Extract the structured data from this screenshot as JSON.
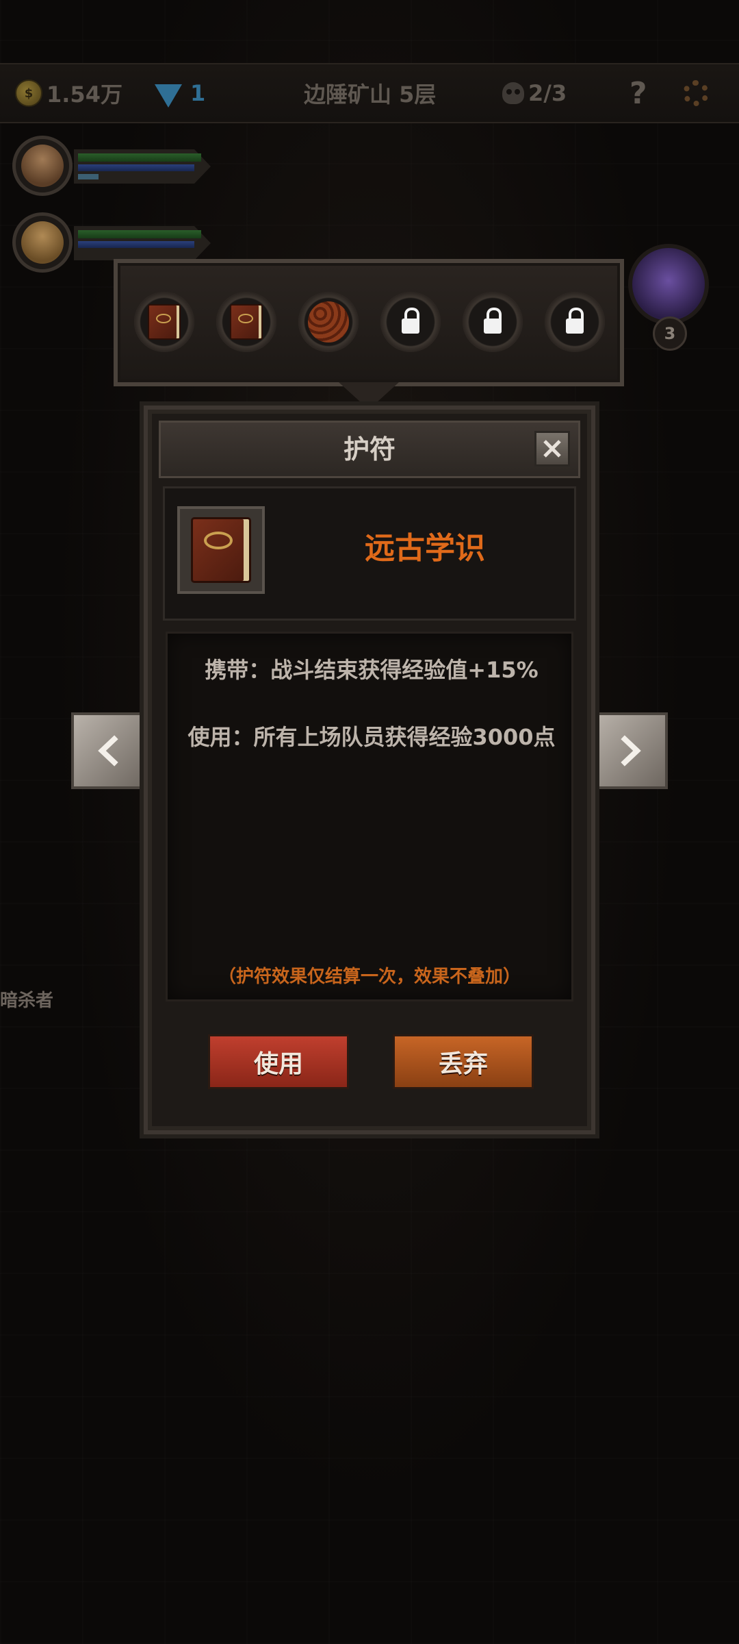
{
  "topbar": {
    "gold": "1.54万",
    "gems": "1",
    "location": "边陲矿山 5层",
    "kills": "2/3",
    "help": "?",
    "coin_glyph": "$"
  },
  "boss": {
    "level": "3"
  },
  "side_label": "暗杀者",
  "amulet_slots": [
    {
      "type": "book"
    },
    {
      "type": "book"
    },
    {
      "type": "scale"
    },
    {
      "type": "locked"
    },
    {
      "type": "locked"
    },
    {
      "type": "locked"
    }
  ],
  "dialog": {
    "title": "护符",
    "item_name": "远古学识",
    "carry": "携带：战斗结束获得经验值+15%",
    "use": "使用：所有上场队员获得经验3000点",
    "note": "（护符效果仅结算一次，效果不叠加）",
    "use_button": "使用",
    "discard_button": "丢弃"
  },
  "colors": {
    "accent_orange": "#e06a1a",
    "use_red": "#c03f2e",
    "discard_orange": "#c76526"
  }
}
